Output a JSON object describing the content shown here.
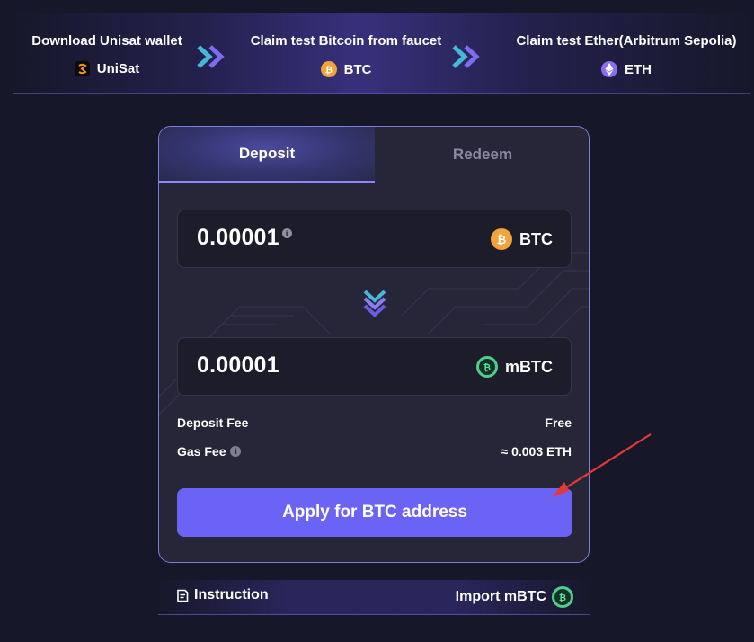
{
  "steps": [
    {
      "title": "Download Unisat wallet",
      "token": "UniSat",
      "icon": "unisat-icon"
    },
    {
      "title": "Claim test Bitcoin from faucet",
      "token": "BTC",
      "icon": "btc-icon"
    },
    {
      "title": "Claim test Ether(Arbitrum Sepolia)",
      "token": "ETH",
      "icon": "eth-icon"
    }
  ],
  "tabs": {
    "deposit": "Deposit",
    "redeem": "Redeem",
    "active": "Deposit"
  },
  "from": {
    "amount": "0.00001",
    "asset": "BTC",
    "info_glyph": "i"
  },
  "to": {
    "amount": "0.00001",
    "asset": "mBTC"
  },
  "fees": {
    "deposit_label": "Deposit Fee",
    "deposit_value": "Free",
    "gas_label": "Gas Fee",
    "gas_value": "≈ 0.003 ETH",
    "info_glyph": "i"
  },
  "apply_button": "Apply for BTC address",
  "footer": {
    "instruction": "Instruction",
    "import": "Import mBTC"
  },
  "colors": {
    "background": "#17172a",
    "card": "#272639",
    "accent": "#6b63f6",
    "btc": "#f2a33a",
    "mbtc": "#4fd08a",
    "eth": "#8b6cf0",
    "annotation_arrow": "#e53935"
  }
}
